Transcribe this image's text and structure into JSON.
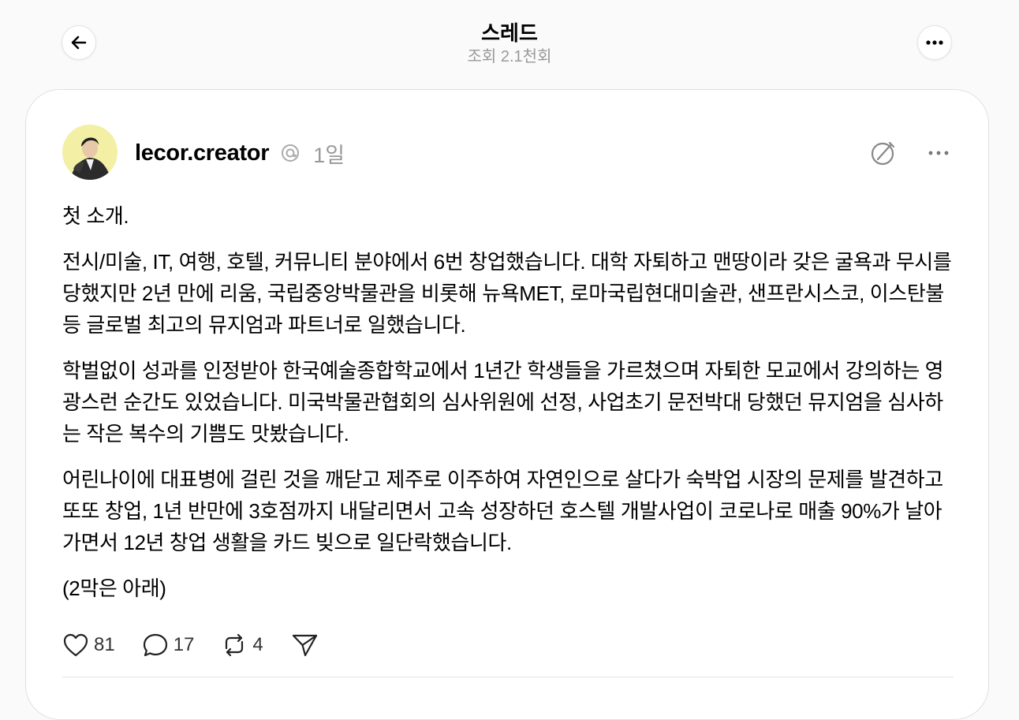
{
  "header": {
    "title": "스레드",
    "views": "조회 2.1천회"
  },
  "post": {
    "username": "lecor.creator",
    "time": "1일",
    "paragraphs": [
      "첫 소개.",
      "전시/미술, IT, 여행, 호텔, 커뮤니티 분야에서 6번 창업했습니다. 대학 자퇴하고 맨땅이라 갖은 굴욕과 무시를 당했지만 2년 만에 리움, 국립중앙박물관을 비롯해 뉴욕MET, 로마국립현대미술관, 샌프란시스코, 이스탄불 등 글로벌 최고의 뮤지엄과 파트너로 일했습니다.",
      "학벌없이 성과를 인정받아 한국예술종합학교에서 1년간 학생들을 가르쳤으며 자퇴한 모교에서 강의하는 영광스런 순간도 있었습니다. 미국박물관협회의 심사위원에 선정, 사업초기 문전박대 당했던 뮤지엄을 심사하는 작은 복수의 기쁨도 맛봤습니다.",
      "어린나이에 대표병에 걸린 것을 깨닫고 제주로 이주하여 자연인으로 살다가 숙박업 시장의 문제를 발견하고 또또 창업, 1년 반만에 3호점까지 내달리면서 고속 성장하던 호스텔 개발사업이 코로나로 매출 90%가 날아가면서 12년 창업 생활을 카드 빚으로 일단락했습니다.",
      "(2막은 아래)"
    ],
    "likes": "81",
    "comments": "17",
    "reposts": "4"
  },
  "icons": {
    "back": "arrow-left-icon",
    "more": "more-horizontal-icon",
    "verified": "threads-badge-icon",
    "edit": "edit-slash-icon",
    "like": "heart-icon",
    "comment": "comment-bubble-icon",
    "repost": "repost-icon",
    "share": "send-icon"
  }
}
